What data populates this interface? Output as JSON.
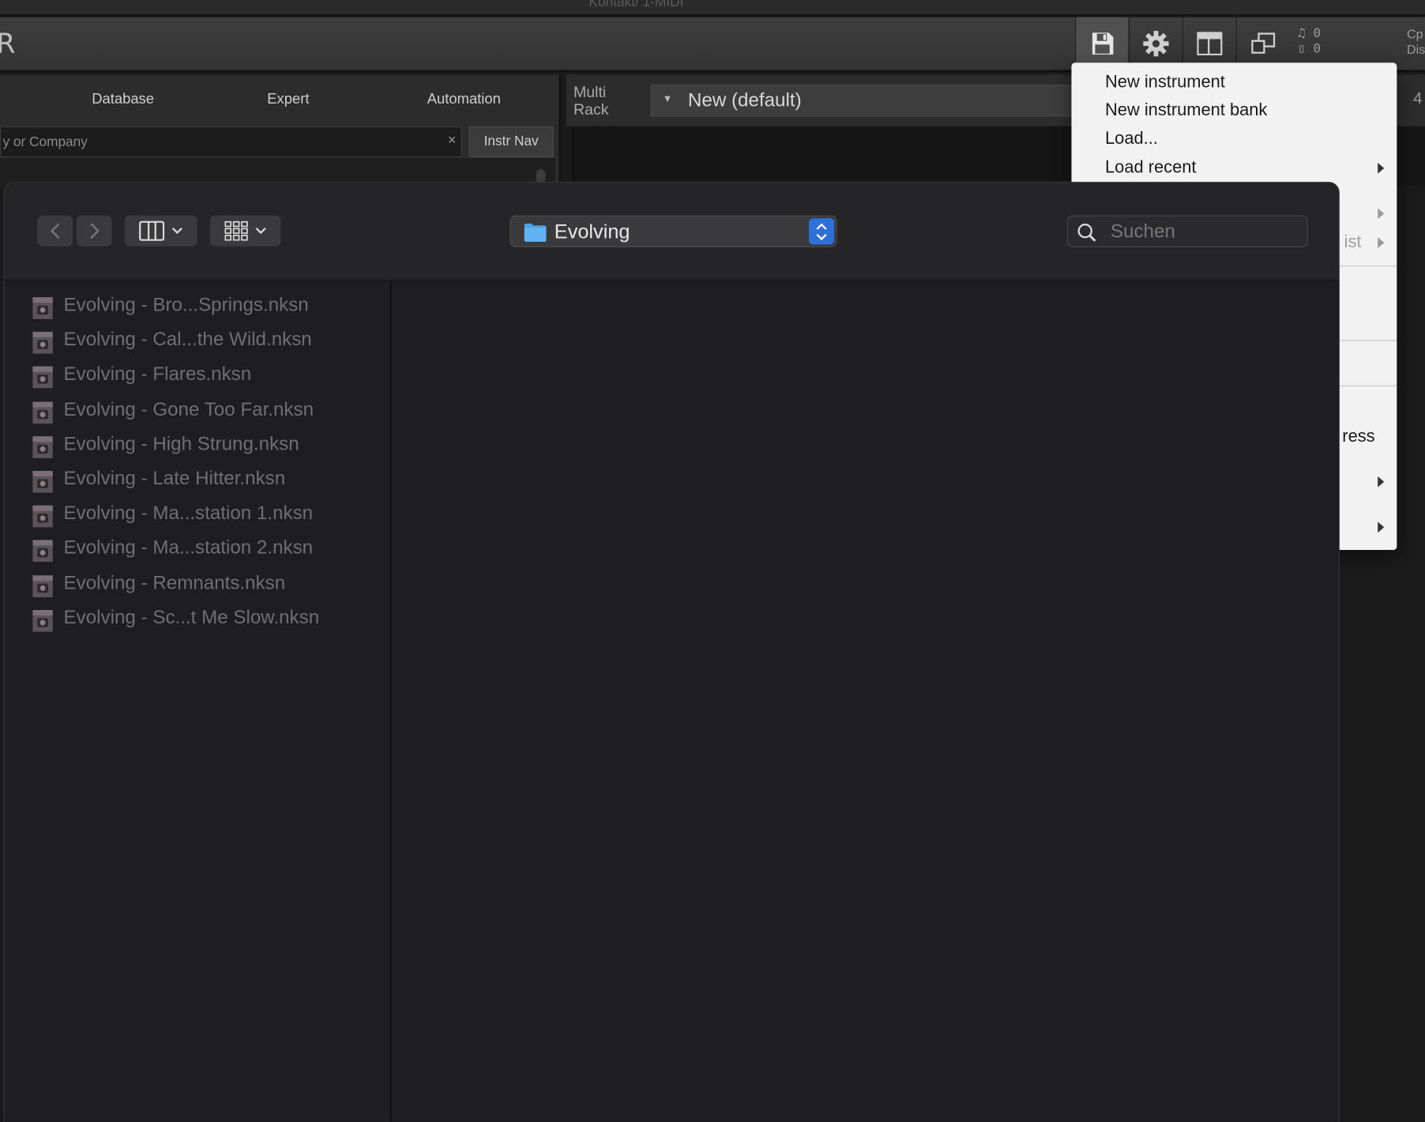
{
  "window": {
    "title": "Kontakt/ 1-MIDI"
  },
  "header": {
    "logo_text": "R",
    "meter_line1": "0",
    "meter_line2": "0",
    "cpu_line1": "Cp",
    "cpu_line2": "Dis"
  },
  "browser": {
    "tabs": [
      {
        "label": "Database"
      },
      {
        "label": "Expert"
      },
      {
        "label": "Automation"
      }
    ],
    "search_placeholder": "y or Company",
    "clear_label": "×",
    "instr_nav_label": "Instr Nav"
  },
  "rack": {
    "label_line1": "Multi",
    "label_line2": "Rack",
    "preset_name": "New (default)",
    "page_number": "4"
  },
  "menu": {
    "items": [
      {
        "label": "New instrument"
      },
      {
        "label": "New instrument bank"
      },
      {
        "label": "Load..."
      },
      {
        "label": "Load recent"
      }
    ],
    "partial_list_label": "ist",
    "partial_press_label": "ress"
  },
  "dialog": {
    "current_folder": "Evolving",
    "search_placeholder": "Suchen",
    "files": [
      {
        "name": "Evolving - Bro...Springs.nksn"
      },
      {
        "name": "Evolving - Cal...the Wild.nksn"
      },
      {
        "name": "Evolving - Flares.nksn"
      },
      {
        "name": "Evolving - Gone Too Far.nksn"
      },
      {
        "name": "Evolving - High Strung.nksn"
      },
      {
        "name": "Evolving - Late Hitter.nksn"
      },
      {
        "name": "Evolving - Ma...station 1.nksn"
      },
      {
        "name": "Evolving - Ma...station 2.nksn"
      },
      {
        "name": "Evolving - Remnants.nksn"
      },
      {
        "name": "Evolving - Sc...t Me Slow.nksn"
      }
    ],
    "file_icon": "nksn-file-icon"
  },
  "colors": {
    "accent": "#2f6fd8",
    "menu_bg": "#f2f2f2",
    "dialog_bg": "#1e1e20"
  }
}
